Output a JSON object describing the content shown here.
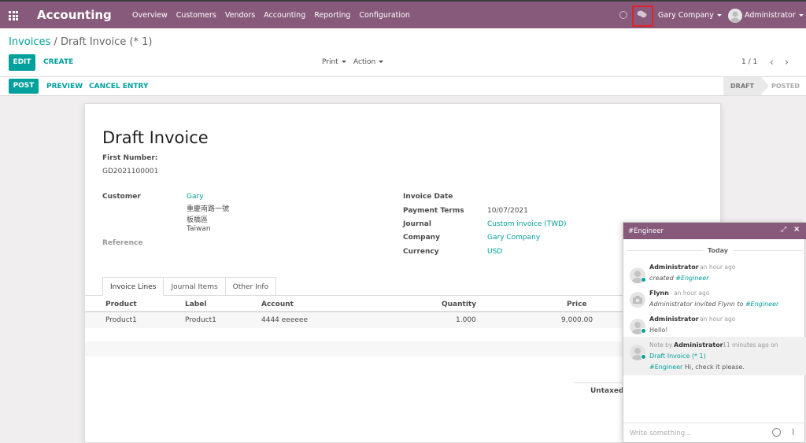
{
  "navbar": {
    "brand": "Accounting",
    "menu": [
      "Overview",
      "Customers",
      "Vendors",
      "Accounting",
      "Reporting",
      "Configuration"
    ],
    "company": "Gary Company",
    "user": "Administrator"
  },
  "breadcrumb": {
    "parent": "Invoices",
    "separator": "/",
    "current": "Draft Invoice (* 1)"
  },
  "control": {
    "edit": "EDIT",
    "create": "CREATE",
    "print": "Print",
    "action": "Action",
    "pager": "1 / 1"
  },
  "status": {
    "post": "POST",
    "preview": "PREVIEW",
    "cancel_entry": "CANCEL ENTRY",
    "stage_draft": "DRAFT",
    "stage_posted": "POSTED"
  },
  "sheet": {
    "title": "Draft Invoice",
    "first_number_label": "First Number:",
    "first_number": "GD2021100001",
    "customer_label": "Customer",
    "customer_name": "Gary",
    "address_line1": "重慶南路一號",
    "address_line2": "板橋區",
    "address_line3": "Taiwan",
    "reference_label": "Reference",
    "invoice_date_label": "Invoice Date",
    "payment_terms_label": "Payment Terms",
    "payment_terms": "10/07/2021",
    "journal_label": "Journal",
    "journal": "Custom invoice (TWD)",
    "company_label": "Company",
    "company": "Gary Company",
    "currency_label": "Currency",
    "currency": "USD",
    "tabs": [
      "Invoice Lines",
      "Journal Items",
      "Other Info"
    ],
    "columns": [
      "Product",
      "Label",
      "Account",
      "Quantity",
      "Price"
    ],
    "rows": [
      {
        "product": "Product1",
        "label": "Product1",
        "account": "4444 eeeeee",
        "quantity": "1.000",
        "price": "9,000.00"
      }
    ],
    "untaxed_label": "Untaxed A"
  },
  "chat": {
    "title": "#Engineer",
    "day": "Today",
    "messages": [
      {
        "author": "Administrator",
        "time": "- an hour ago",
        "pre": "created ",
        "tag": "#Engineer",
        "post": ""
      },
      {
        "author": "Flynn",
        "time": "- an hour ago",
        "pre": "Administrator invited Flynn to ",
        "tag": "#Engineer",
        "post": ""
      },
      {
        "author": "Administrator",
        "time": "- an hour ago",
        "pre": "Hello!",
        "tag": "",
        "post": ""
      }
    ],
    "note": {
      "prefix": "Note by",
      "author": "Administrator",
      "time": "- 11 minutes ago on",
      "record": "Draft Invoice (* 1)",
      "tag": "#Engineer",
      "text": "Hi, check it please."
    },
    "placeholder": "Write something..."
  },
  "icons": {
    "apps": "apps-grid-icon",
    "clock": "clock-icon",
    "chat": "chat-bubbles-icon",
    "expand": "expand-icon",
    "close": "close-icon",
    "emoji": "emoji-icon",
    "attach": "paperclip-icon"
  },
  "colors": {
    "brand": "#875a7b",
    "accent": "#00a09d",
    "highlight": "#e0222a"
  }
}
